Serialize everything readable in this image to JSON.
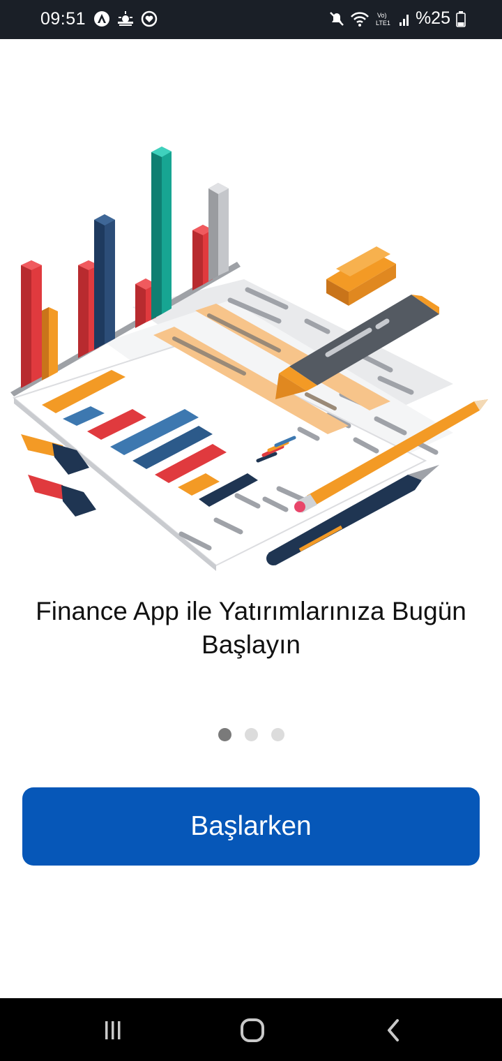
{
  "status_bar": {
    "time": "09:51",
    "battery_percent": "%25",
    "left_icons": [
      "autopilot-icon",
      "weather-icon",
      "heart-app-icon"
    ],
    "right_icons": [
      "mute-icon",
      "wifi-icon",
      "volte-lte-icon",
      "signal-icon",
      "battery-icon"
    ]
  },
  "illustration": {
    "icon": "finance-report-illustration",
    "colors": [
      "#e03a3e",
      "#f39a25",
      "#2c4d78",
      "#17a592",
      "#b7b9bd"
    ]
  },
  "onboarding": {
    "title": "Finance App ile Yatırımlarınıza Bugün Başlayın",
    "page_count": 3,
    "active_page": 1
  },
  "cta": {
    "label": "Başlarken",
    "color": "#0657b8"
  },
  "nav_bar": {
    "buttons": [
      "recents-icon",
      "home-icon",
      "back-icon"
    ]
  }
}
